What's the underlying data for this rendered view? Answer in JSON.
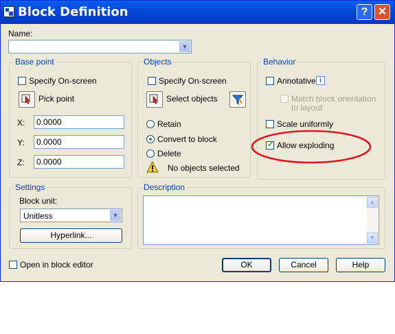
{
  "window": {
    "title": "Block Definition",
    "help_label": "?",
    "close_label": "✕"
  },
  "name": {
    "label": "Name:",
    "value": ""
  },
  "base_point": {
    "title": "Base point",
    "specify_onscreen": "Specify On-screen",
    "pick_point": "Pick point",
    "x_label": "X:",
    "x_value": "0.0000",
    "y_label": "Y:",
    "y_value": "0.0000",
    "z_label": "Z:",
    "z_value": "0.0000"
  },
  "objects": {
    "title": "Objects",
    "specify_onscreen": "Specify On-screen",
    "select_objects": "Select objects",
    "retain": "Retain",
    "convert_to_block": "Convert to block",
    "delete": "Delete",
    "status": "No objects selected",
    "selected_option": "Convert to block"
  },
  "behavior": {
    "title": "Behavior",
    "annotative": "Annotative",
    "info_label": "i",
    "match_orientation_line1": "Match block orientation",
    "match_orientation_line2": "to layout",
    "scale_uniformly": "Scale uniformly",
    "allow_exploding": "Allow exploding",
    "allow_exploding_checked": true,
    "highlight_color": "#e0141c"
  },
  "settings": {
    "title": "Settings",
    "block_unit_label": "Block unit:",
    "block_unit_value": "Unitless",
    "hyperlink_button": "Hyperlink..."
  },
  "description": {
    "title": "Description",
    "value": ""
  },
  "footer": {
    "open_in_editor": "Open in block editor",
    "ok": "OK",
    "cancel": "Cancel",
    "help": "Help"
  }
}
